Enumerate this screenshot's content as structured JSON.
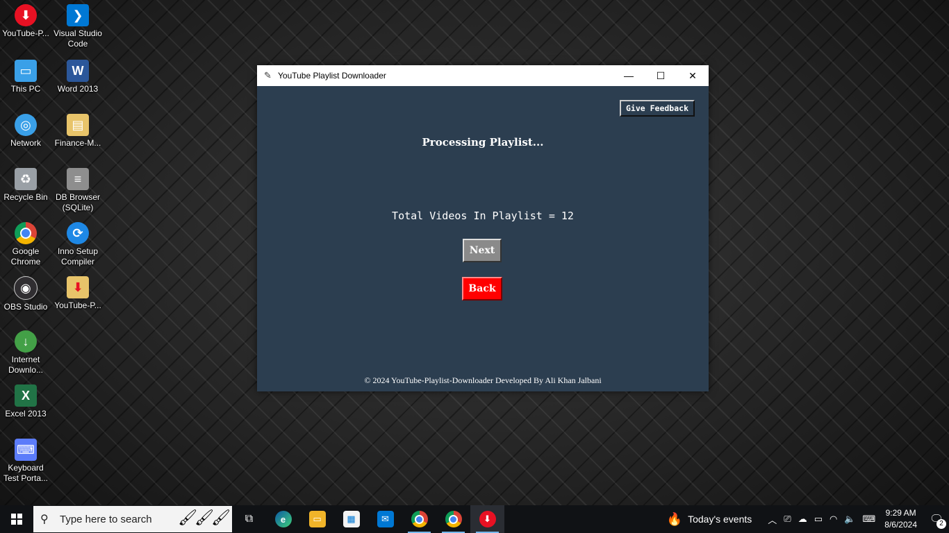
{
  "desktop": {
    "icons": [
      {
        "label": "YouTube-P...",
        "icon": "youtube-downloader-icon",
        "color": "#e81123"
      },
      {
        "label": "Visual Studio Code",
        "icon": "vscode-icon",
        "color": "#0078d4"
      },
      {
        "label": "This PC",
        "icon": "computer-icon",
        "color": "#3aa0e8"
      },
      {
        "label": "Word 2013",
        "icon": "word-icon",
        "color": "#2b579a"
      },
      {
        "label": "Network",
        "icon": "network-icon",
        "color": "#3aa0e8"
      },
      {
        "label": "Finance-M...",
        "icon": "folder-icon",
        "color": "#e8c46a"
      },
      {
        "label": "Recycle Bin",
        "icon": "recycle-bin-icon",
        "color": "#9aa0a6"
      },
      {
        "label": "DB Browser (SQLite)",
        "icon": "database-icon",
        "color": "#8e8e8e"
      },
      {
        "label": "Google Chrome",
        "icon": "chrome-icon",
        "color": "#db4437"
      },
      {
        "label": "Inno Setup Compiler",
        "icon": "inno-setup-icon",
        "color": "#1e88e5"
      },
      {
        "label": "OBS Studio",
        "icon": "obs-icon",
        "color": "#302e31"
      },
      {
        "label": "YouTube-P...",
        "icon": "youtube-downloader-file-icon",
        "color": "#e8c46a"
      },
      {
        "label": "Internet Downlo...",
        "icon": "idm-icon",
        "color": "#43a047"
      },
      {
        "label": "Excel 2013",
        "icon": "excel-icon",
        "color": "#217346"
      },
      {
        "label": "Keyboard Test Porta...",
        "icon": "keyboard-test-icon",
        "color": "#5c7cfa"
      }
    ]
  },
  "window": {
    "title": "YouTube Playlist Downloader",
    "minimize": "—",
    "maximize": "☐",
    "close": "✕",
    "feedback_label": "Give Feedback",
    "heading": "Processing Playlist...",
    "total_text": "Total Videos In Playlist = 12",
    "next_label": "Next",
    "back_label": "Back",
    "footer": "© 2024 YouTube-Playlist-Downloader Developed By Ali Khan Jalbani",
    "bg_color": "#2c3e50",
    "back_color": "#ff0000",
    "next_color": "#8a8a8a"
  },
  "taskbar": {
    "search_placeholder": "Type here to search",
    "apps": [
      {
        "icon": "task-view-icon"
      },
      {
        "icon": "edge-icon"
      },
      {
        "icon": "file-explorer-icon"
      },
      {
        "icon": "microsoft-store-icon"
      },
      {
        "icon": "mail-icon"
      },
      {
        "icon": "chrome-icon"
      },
      {
        "icon": "chrome-profile-icon"
      },
      {
        "icon": "youtube-downloader-icon"
      }
    ],
    "news": "Today's events",
    "time": "9:29 AM",
    "date": "8/6/2024",
    "notification_count": "2"
  }
}
